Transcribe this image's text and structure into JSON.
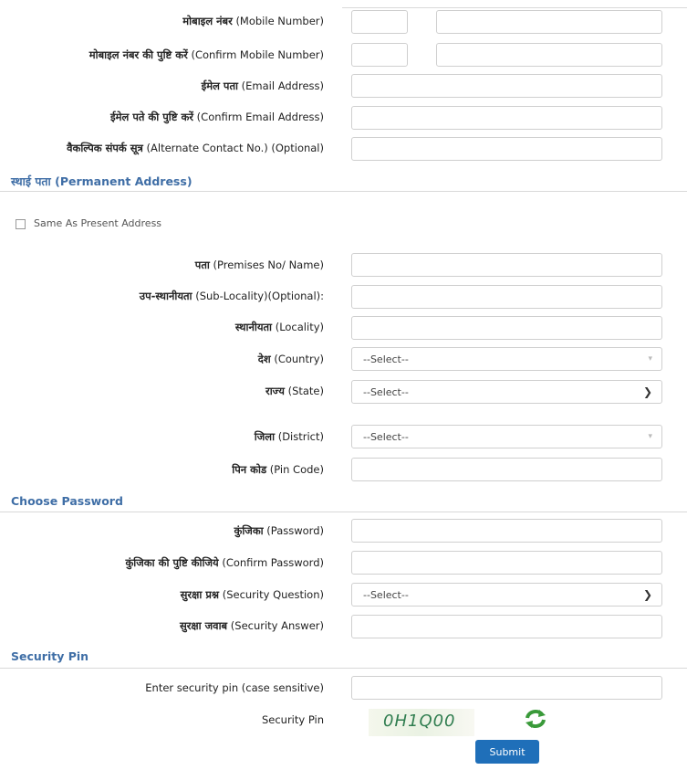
{
  "contact": {
    "mobile_label_hi": "मोबाइल नंबर",
    "mobile_label_en": "(Mobile Number)",
    "confirm_mobile_label_hi": "मोबाइल नंबर की पुष्टि करें",
    "confirm_mobile_label_en": "(Confirm Mobile Number)",
    "email_label_hi": "ईमेल पता",
    "email_label_en": "(Email Address)",
    "confirm_email_label_hi": "ईमेल पते की पुष्टि करें",
    "confirm_email_label_en": "(Confirm Email Address)",
    "alt_contact_label_hi": "वैकल्पिक संपर्क सूत्र",
    "alt_contact_label_en": "(Alternate Contact No.) (Optional)"
  },
  "permanent_address": {
    "section_title": "स्थाई पता (Permanent Address)",
    "same_as_present_label": "Same As Present Address",
    "premises_label_hi": "पता",
    "premises_label_en": "(Premises No/ Name)",
    "sublocality_label_hi": "उप-स्थानीयता",
    "sublocality_label_en": "(Sub-Locality)(Optional):",
    "locality_label_hi": "स्थानीयता",
    "locality_label_en": "(Locality)",
    "country_label_hi": "देश",
    "country_label_en": "(Country)",
    "country_value": "--Select--",
    "state_label_hi": "राज्य",
    "state_label_en": "(State)",
    "state_value": "--Select--",
    "district_label_hi": "जिला",
    "district_label_en": "(District)",
    "district_value": "--Select--",
    "pin_label_hi": "पिन कोड",
    "pin_label_en": "(Pin Code)"
  },
  "password": {
    "section_title": "Choose Password",
    "password_label_hi": "कुंजिका",
    "password_label_en": "(Password)",
    "confirm_password_label_hi": "कुंजिका की पुष्टि कीजिये",
    "confirm_password_label_en": "(Confirm Password)",
    "security_question_label_hi": "सुरक्षा प्रश्न",
    "security_question_label_en": "(Security Question)",
    "security_question_value": "--Select--",
    "security_answer_label_hi": "सुरक्षा जवाब",
    "security_answer_label_en": "(Security Answer)"
  },
  "security_pin": {
    "section_title": "Security Pin",
    "enter_pin_label": "Enter security pin (case sensitive)",
    "pin_label": "Security Pin",
    "captcha_text": "0H1Q00",
    "submit_label": "Submit"
  },
  "colors": {
    "section_title": "#3f6ea6",
    "submit_button": "#1f6fb9",
    "captcha_text": "#2f7d4f"
  },
  "icons": {
    "refresh": "refresh-icon",
    "dropdown": "chevron-down-icon"
  }
}
